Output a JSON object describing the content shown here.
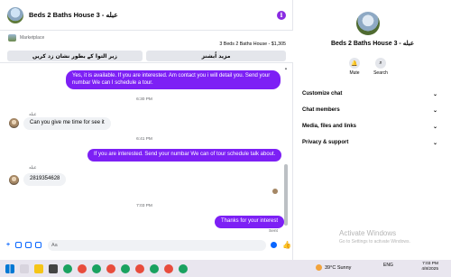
{
  "header": {
    "title": "Beds 2 Baths House 3 - عبله"
  },
  "listing": {
    "marketplace_label": "Marketplace",
    "title": "3 Beds 2 Baths House - $1,305",
    "button_left": "زیر التوا کے بطور نشان زد کریں",
    "button_right": "مزید اُبشنز"
  },
  "messages": [
    {
      "type": "out",
      "text": "Yes, it is available. If you are interested. Am contact you i will detail you. Send your numbar We can I schedule a tour."
    },
    {
      "type": "time",
      "text": "6:30 PM"
    },
    {
      "type": "sender",
      "text": "عبله"
    },
    {
      "type": "in",
      "text": "Can you give me time for see it"
    },
    {
      "type": "time",
      "text": "6:41 PM"
    },
    {
      "type": "out",
      "text": "If you are interested. Send your numbar We can of tour  schedule talk about."
    },
    {
      "type": "sender",
      "text": "عبله"
    },
    {
      "type": "in",
      "text": "2819354628"
    },
    {
      "type": "time",
      "text": "7:03 PM"
    },
    {
      "type": "out",
      "text": "Thanks for your interest"
    },
    {
      "type": "status",
      "text": "Sent"
    }
  ],
  "composer": {
    "placeholder": "Aa"
  },
  "sidebar": {
    "title": "Beds 2 Baths House 3 - عبله",
    "actions": [
      {
        "label": "Mute",
        "icon": "bell-icon"
      },
      {
        "label": "Search",
        "icon": "search-icon"
      }
    ],
    "sections": [
      {
        "label": "Customize chat"
      },
      {
        "label": "Chat members"
      },
      {
        "label": "Media, files and links"
      },
      {
        "label": "Privacy & support"
      }
    ],
    "watermark_title": "Activate Windows",
    "watermark_sub": "Go to Settings to activate Windows."
  },
  "taskbar": {
    "weather_temp": "39°C",
    "weather_text": "Sunny",
    "lang": "ENG",
    "time": "7:03 PM",
    "date": "4/8/2025"
  },
  "colors": {
    "accent": "#7d20f5",
    "brand_blue": "#0866ff"
  }
}
